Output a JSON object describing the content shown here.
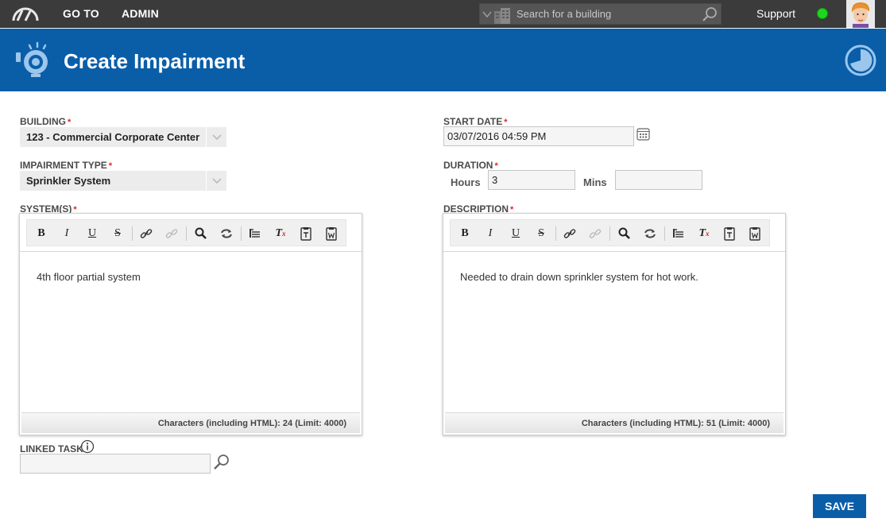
{
  "nav": {
    "goto_label": "GO TO",
    "admin_label": "ADMIN",
    "search_placeholder": "Search for a building",
    "support_label": "Support",
    "status_color": "#1fd61f"
  },
  "header": {
    "title": "Create Impairment",
    "background": "#0a5ea8"
  },
  "form": {
    "building": {
      "label": "BUILDING",
      "value": "123 - Commercial Corporate Center"
    },
    "impairment_type": {
      "label": "IMPAIRMENT TYPE",
      "value": "Sprinkler System"
    },
    "start_date": {
      "label": "START DATE",
      "value": "03/07/2016 04:59 PM"
    },
    "duration": {
      "label": "DURATION",
      "hours_label": "Hours",
      "hours_value": "3",
      "mins_label": "Mins",
      "mins_value": ""
    },
    "systems": {
      "label": "SYSTEM(S)",
      "content": "4th floor partial system",
      "char_count": "Characters (including HTML): 24 (Limit: 4000)"
    },
    "description": {
      "label": "DESCRIPTION",
      "content": "Needed to drain down sprinkler system for hot work.",
      "char_count": "Characters (including HTML): 51 (Limit: 4000)"
    },
    "linked_task": {
      "label": "LINKED TASK",
      "value": ""
    },
    "required_marker": "*"
  },
  "toolbar": {
    "bold": "B",
    "italic": "I",
    "underline": "U",
    "strike": "S",
    "clear_format": "T"
  },
  "actions": {
    "save_label": "SAVE"
  }
}
